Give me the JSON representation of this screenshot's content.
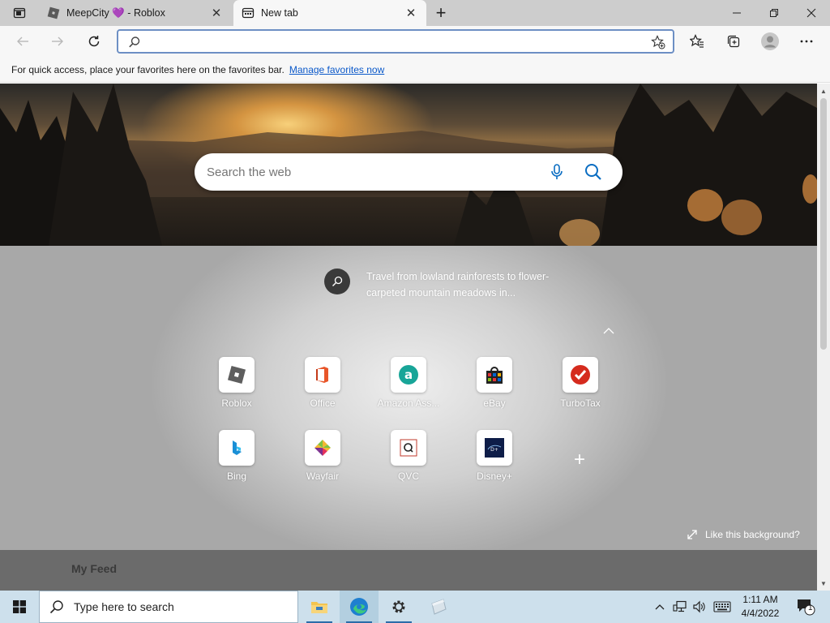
{
  "tabs": [
    {
      "title": "MeepCity 💜 - Roblox",
      "active": false
    },
    {
      "title": "New tab",
      "active": true
    }
  ],
  "tab_actions": {
    "new_tab": "+"
  },
  "window_controls": {
    "minimize": "–",
    "maximize": "◻",
    "close": "✕"
  },
  "address_bar": {
    "value": "",
    "placeholder": ""
  },
  "favorites_bar": {
    "message": "For quick access, place your favorites here on the favorites bar.",
    "link": "Manage favorites now"
  },
  "search": {
    "placeholder": "Search the web"
  },
  "tip": {
    "text": "Travel from lowland rainforests to flower-carpeted mountain meadows in..."
  },
  "quick_links": [
    {
      "label": "Roblox",
      "icon": "roblox-icon"
    },
    {
      "label": "Office",
      "icon": "office-icon"
    },
    {
      "label": "Amazon Ass...",
      "icon": "amazon-icon"
    },
    {
      "label": "eBay",
      "icon": "ebay-icon"
    },
    {
      "label": "TurboTax",
      "icon": "turbotax-icon"
    },
    {
      "label": "Bing",
      "icon": "bing-icon"
    },
    {
      "label": "Wayfair",
      "icon": "wayfair-icon"
    },
    {
      "label": "QVC",
      "icon": "qvc-icon"
    },
    {
      "label": "Disney+",
      "icon": "disney-icon"
    }
  ],
  "add_link": "+",
  "like_background": "Like this background?",
  "feed": {
    "title": "My Feed"
  },
  "taskbar": {
    "search_placeholder": "Type here to search",
    "time": "1:11 AM",
    "date": "4/4/2022",
    "notification_count": "1"
  },
  "colors": {
    "accent": "#0a58c9",
    "address_border": "#6d8fc4",
    "taskbar": "#cde0ec"
  }
}
